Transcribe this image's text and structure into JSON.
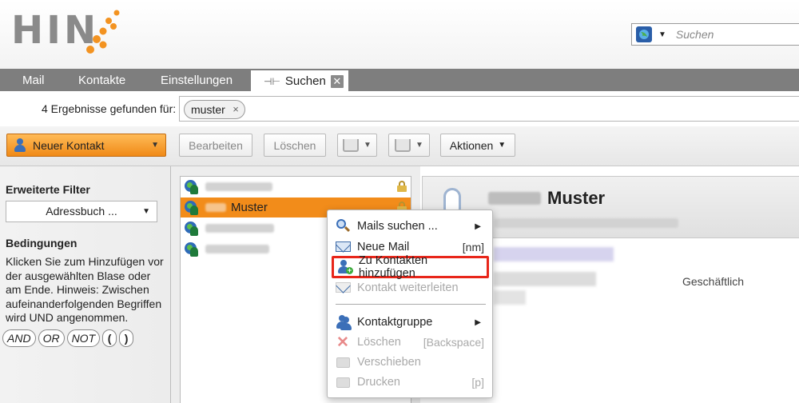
{
  "brand": {
    "logo_text": "HIN",
    "dot_color": "#f39321"
  },
  "search": {
    "placeholder": "Suchen",
    "icon": "globe-search-icon"
  },
  "tabs": [
    {
      "label": "Mail"
    },
    {
      "label": "Kontakte"
    },
    {
      "label": "Einstellungen"
    },
    {
      "label": "Suchen",
      "active": true,
      "pin_icon": "pin-icon",
      "close_icon": "close-icon"
    }
  ],
  "results": {
    "label": "4 Ergebnisse gefunden für:",
    "query_chip": "muster",
    "chip_close": "×"
  },
  "toolbar": {
    "new_contact": "Neuer Kontakt",
    "edit": "Bearbeiten",
    "delete": "Löschen",
    "actions": "Aktionen"
  },
  "filters": {
    "title": "Erweiterte Filter",
    "addressbook": "Adressbuch ...",
    "conditions_title": "Bedingungen",
    "help_text": "Klicken Sie zum Hinzufügen vor der ausgewählten Blase oder am Ende. Hinweis: Zwischen aufeinanderfolgenden Begriffen wird UND angenommen.",
    "operators": [
      "AND",
      "OR",
      "NOT",
      "(",
      ")"
    ]
  },
  "contacts": {
    "selected_surname": "Muster",
    "rows": [
      {
        "selected": false,
        "locked": true
      },
      {
        "selected": true,
        "locked": true
      },
      {
        "selected": false,
        "locked": false
      },
      {
        "selected": false,
        "locked": false
      }
    ]
  },
  "detail": {
    "surname": "Muster",
    "type_label": "Geschäftlich"
  },
  "context_menu": {
    "items": [
      {
        "label": "Mails suchen ...",
        "submenu": true,
        "icon": "magnifier-icon",
        "enabled": true
      },
      {
        "label": "Neue Mail",
        "shortcut": "[nm]",
        "icon": "envelope-icon",
        "enabled": true
      },
      {
        "label": "Zu Kontakten hinzufügen",
        "icon": "add-contact-icon",
        "enabled": true,
        "highlighted": true
      },
      {
        "label": "Kontakt weiterleiten",
        "icon": "forward-contact-icon",
        "enabled": false
      },
      {
        "label": "Kontaktgruppe",
        "submenu": true,
        "icon": "contact-group-icon",
        "enabled": true
      },
      {
        "label": "Löschen",
        "shortcut": "[Backspace]",
        "icon": "delete-icon",
        "enabled": false
      },
      {
        "label": "Verschieben",
        "icon": "move-icon",
        "enabled": false
      },
      {
        "label": "Drucken",
        "shortcut": "[p]",
        "icon": "print-icon",
        "enabled": false
      }
    ],
    "highlight_color": "#e8261a"
  },
  "colors": {
    "accent": "#f28c1a",
    "tabbar": "#7e7e7e"
  }
}
